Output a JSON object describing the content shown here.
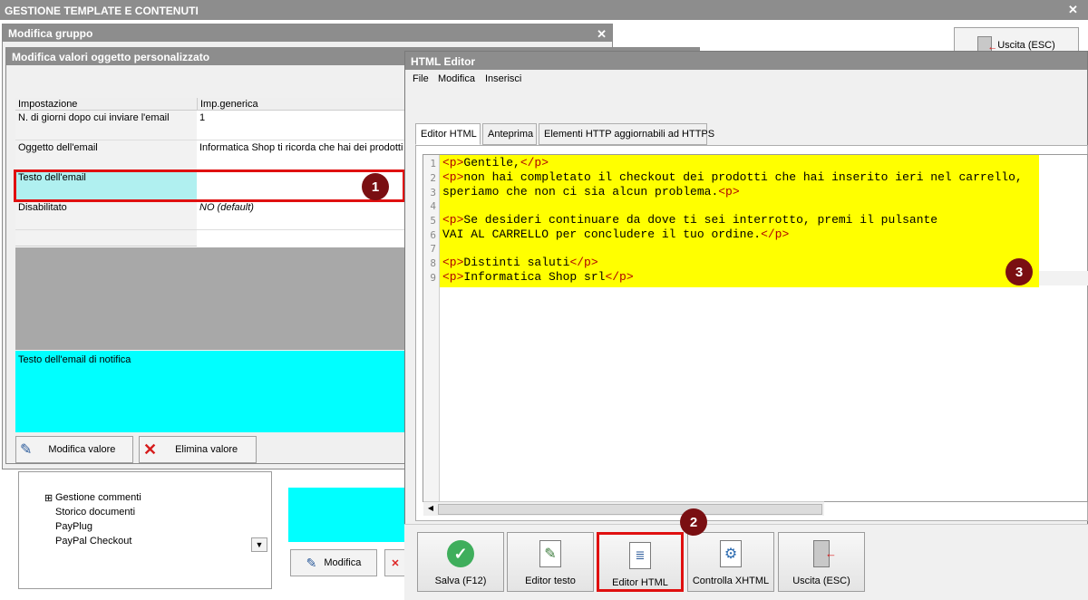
{
  "main_window": {
    "title": "GESTIONE TEMPLATE E CONTENUTI",
    "exit_label": "Uscita (ESC)"
  },
  "group_window": {
    "title": "Modifica gruppo"
  },
  "custom_window": {
    "title": "Modifica valori oggetto personalizzato",
    "grid_headers": [
      "Impostazione",
      "Imp.generica"
    ],
    "rows": [
      {
        "name": "N. di giorni dopo cui inviare l'email",
        "value": "1"
      },
      {
        "name": "Oggetto dell'email",
        "value": "Informatica Shop ti ricorda che hai dei prodotti a"
      },
      {
        "name": "Testo dell'email",
        "value": ""
      },
      {
        "name": "Disabilitato",
        "value": "NO (default)"
      }
    ],
    "notify_label": "Testo dell'email di notifica",
    "modify_label": "Modifica valore",
    "delete_label": "Elimina valore"
  },
  "tree": {
    "items": [
      "Gestione commenti",
      "Storico documenti",
      "PayPlug",
      "PayPal Checkout"
    ]
  },
  "bg_modify_label": "Modifica",
  "html_editor": {
    "title": "HTML Editor",
    "menu": [
      "File",
      "Modifica",
      "Inserisci"
    ],
    "tabs": [
      "Editor HTML",
      "Anteprima",
      "Elementi HTTP aggiornabili ad HTTPS"
    ],
    "line_numbers": [
      "1",
      "2",
      "3",
      "4",
      "5",
      "6",
      "7",
      "8",
      "9"
    ],
    "lines": [
      "<p>Gentile,</p>",
      "<p>non hai completato il checkout dei prodotti che hai inserito ieri nel carrello,",
      "speriamo che non ci sia alcun problema.<p>",
      "",
      "<p>Se desideri continuare da dove ti sei interrotto, premi il pulsante",
      "VAI AL CARRELLO per concludere il tuo ordine.</p>",
      "",
      "<p>Distinti saluti</p>",
      "<p>Informatica Shop srl</p>"
    ],
    "toolbar": [
      "Salva (F12)",
      "Editor testo",
      "Editor HTML",
      "Controlla XHTML",
      "Uscita (ESC)"
    ]
  },
  "badges": [
    "1",
    "2",
    "3"
  ],
  "colors": {
    "highlight": "#ffff00",
    "cyan": "#00ffff",
    "selected_row": "#b0f0f0",
    "annotation_red": "#e01010",
    "badge": "#7a0f12"
  }
}
